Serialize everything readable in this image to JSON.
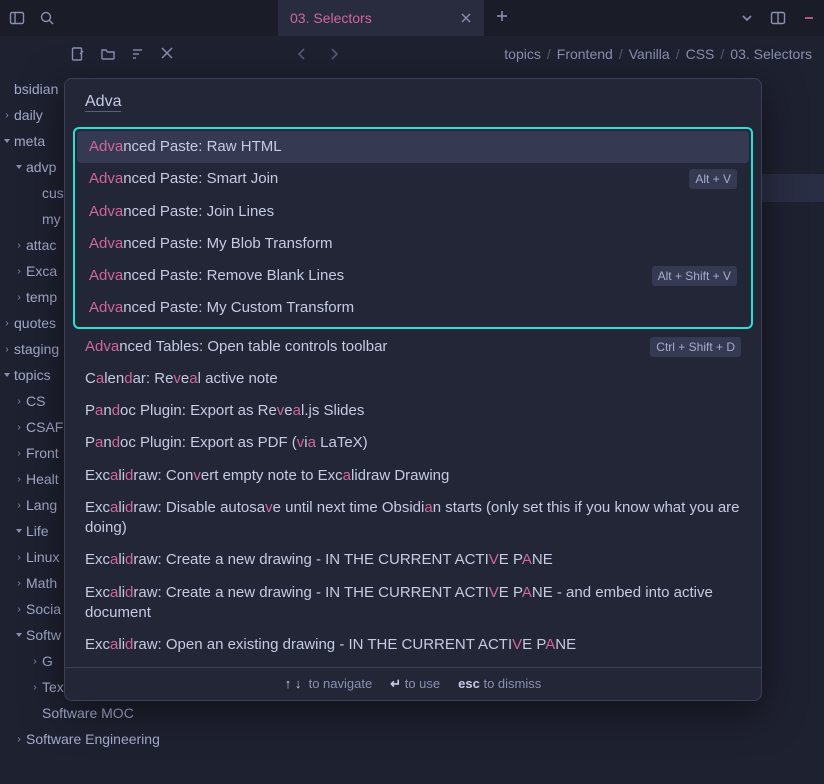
{
  "tab": {
    "title": "03. Selectors"
  },
  "breadcrumb": [
    "topics",
    "Frontend",
    "Vanilla",
    "CSS",
    "03. Selectors"
  ],
  "tree": [
    {
      "label": "bsidian",
      "depth": 0,
      "chev": "none"
    },
    {
      "label": "daily",
      "depth": 0,
      "chev": "right"
    },
    {
      "label": "meta",
      "depth": 0,
      "chev": "down"
    },
    {
      "label": "advp",
      "depth": 1,
      "chev": "down"
    },
    {
      "label": "cust",
      "depth": 2,
      "chev": "none"
    },
    {
      "label": "my",
      "depth": 2,
      "chev": "none"
    },
    {
      "label": "attac",
      "depth": 1,
      "chev": "right"
    },
    {
      "label": "Exca",
      "depth": 1,
      "chev": "right"
    },
    {
      "label": "temp",
      "depth": 1,
      "chev": "right"
    },
    {
      "label": "quotes",
      "depth": 0,
      "chev": "right"
    },
    {
      "label": "staging",
      "depth": 0,
      "chev": "right"
    },
    {
      "label": "topics",
      "depth": 0,
      "chev": "down"
    },
    {
      "label": "CS",
      "depth": 1,
      "chev": "right"
    },
    {
      "label": "CSAF",
      "depth": 1,
      "chev": "right"
    },
    {
      "label": "Front",
      "depth": 1,
      "chev": "right"
    },
    {
      "label": "Healt",
      "depth": 1,
      "chev": "right"
    },
    {
      "label": "Lang",
      "depth": 1,
      "chev": "right"
    },
    {
      "label": "Life",
      "depth": 1,
      "chev": "down"
    },
    {
      "label": "Linux",
      "depth": 1,
      "chev": "right"
    },
    {
      "label": "Math",
      "depth": 1,
      "chev": "right"
    },
    {
      "label": "Socia",
      "depth": 1,
      "chev": "right"
    },
    {
      "label": "Softw",
      "depth": 1,
      "chev": "down"
    },
    {
      "label": "G",
      "depth": 2,
      "chev": "right"
    },
    {
      "label": "Texmacs",
      "depth": 2,
      "chev": "right"
    },
    {
      "label": "Software MOC",
      "depth": 2,
      "chev": "none"
    },
    {
      "label": "Software Engineering",
      "depth": 1,
      "chev": "right"
    }
  ],
  "palette": {
    "query": "Adva",
    "grouped": [
      {
        "segments": [
          {
            "t": "Adva",
            "hl": true
          },
          {
            "t": "nced Paste: Raw HTML"
          }
        ],
        "selected": true
      },
      {
        "segments": [
          {
            "t": "Adva",
            "hl": true
          },
          {
            "t": "nced Paste: Smart Join"
          }
        ],
        "shortcut": "Alt + V"
      },
      {
        "segments": [
          {
            "t": "Adva",
            "hl": true
          },
          {
            "t": "nced Paste: Join Lines"
          }
        ]
      },
      {
        "segments": [
          {
            "t": "Adva",
            "hl": true
          },
          {
            "t": "nced Paste: My Blob Transform"
          }
        ]
      },
      {
        "segments": [
          {
            "t": "Adva",
            "hl": true
          },
          {
            "t": "nced Paste: Remove Blank Lines"
          }
        ],
        "shortcut": "Alt + Shift + V"
      },
      {
        "segments": [
          {
            "t": "Adva",
            "hl": true
          },
          {
            "t": "nced Paste: My Custom Transform"
          }
        ]
      }
    ],
    "rest": [
      {
        "segments": [
          {
            "t": "Adva",
            "hl": true
          },
          {
            "t": "nced Tables: Open table controls toolbar"
          }
        ],
        "shortcut": "Ctrl + Shift + D"
      },
      {
        "segments": [
          {
            "t": "C"
          },
          {
            "t": "a",
            "hl": true
          },
          {
            "t": "len"
          },
          {
            "t": "d",
            "hl": true
          },
          {
            "t": "ar: Re"
          },
          {
            "t": "v",
            "hl": true
          },
          {
            "t": "e"
          },
          {
            "t": "a",
            "hl": true
          },
          {
            "t": "l active note"
          }
        ]
      },
      {
        "segments": [
          {
            "t": "P"
          },
          {
            "t": "a",
            "hl": true
          },
          {
            "t": "n"
          },
          {
            "t": "d",
            "hl": true
          },
          {
            "t": "oc Plugin: Export as Re"
          },
          {
            "t": "v",
            "hl": true
          },
          {
            "t": "e"
          },
          {
            "t": "a",
            "hl": true
          },
          {
            "t": "l.js Slides"
          }
        ]
      },
      {
        "segments": [
          {
            "t": "P"
          },
          {
            "t": "a",
            "hl": true
          },
          {
            "t": "n"
          },
          {
            "t": "d",
            "hl": true
          },
          {
            "t": "oc Plugin: Export as PDF ("
          },
          {
            "t": "v",
            "hl": true
          },
          {
            "t": "i"
          },
          {
            "t": "a",
            "hl": true
          },
          {
            "t": " LaTeX)"
          }
        ]
      },
      {
        "segments": [
          {
            "t": "Exc"
          },
          {
            "t": "a",
            "hl": true
          },
          {
            "t": "li"
          },
          {
            "t": "d",
            "hl": true
          },
          {
            "t": "raw: Con"
          },
          {
            "t": "v",
            "hl": true
          },
          {
            "t": "ert empty note to Exc"
          },
          {
            "t": "a",
            "hl": true
          },
          {
            "t": "lidraw Drawing"
          }
        ]
      },
      {
        "segments": [
          {
            "t": "Exc"
          },
          {
            "t": "a",
            "hl": true
          },
          {
            "t": "li"
          },
          {
            "t": "d",
            "hl": true
          },
          {
            "t": "raw: Disable autosa"
          },
          {
            "t": "v",
            "hl": true
          },
          {
            "t": "e until next time Obsidi"
          },
          {
            "t": "a",
            "hl": true
          },
          {
            "t": "n starts (only set this if you know what you are doing)"
          }
        ]
      },
      {
        "segments": [
          {
            "t": "Exc"
          },
          {
            "t": "a",
            "hl": true
          },
          {
            "t": "li"
          },
          {
            "t": "d",
            "hl": true
          },
          {
            "t": "raw: Create a new drawing - IN THE CURRENT ACTI"
          },
          {
            "t": "V",
            "hl": true
          },
          {
            "t": "E P"
          },
          {
            "t": "A",
            "hl": true
          },
          {
            "t": "NE"
          }
        ]
      },
      {
        "segments": [
          {
            "t": "Exc"
          },
          {
            "t": "a",
            "hl": true
          },
          {
            "t": "li"
          },
          {
            "t": "d",
            "hl": true
          },
          {
            "t": "raw: Create a new drawing - IN THE CURRENT ACTI"
          },
          {
            "t": "V",
            "hl": true
          },
          {
            "t": "E P"
          },
          {
            "t": "A",
            "hl": true
          },
          {
            "t": "NE - and embed into active document"
          }
        ]
      },
      {
        "segments": [
          {
            "t": "Exc"
          },
          {
            "t": "a",
            "hl": true
          },
          {
            "t": "li"
          },
          {
            "t": "d",
            "hl": true
          },
          {
            "t": "raw: Open an existing drawing - IN THE CURRENT ACTI"
          },
          {
            "t": "V",
            "hl": true
          },
          {
            "t": "E P"
          },
          {
            "t": "A",
            "hl": true
          },
          {
            "t": "NE"
          }
        ]
      }
    ],
    "footer": {
      "nav": "to navigate",
      "use": "to use",
      "esc": "esc",
      "dismiss": "to dismiss"
    }
  }
}
